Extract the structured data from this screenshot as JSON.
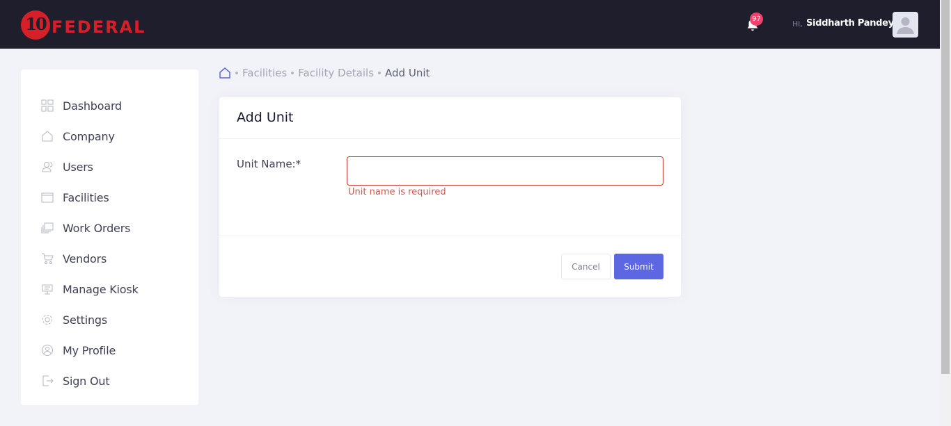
{
  "header": {
    "brand_number": "10",
    "brand_name": "FEDERAL",
    "notification_count": "97",
    "greeting": "Hi,",
    "user_name": "Siddharth Pandey"
  },
  "sidebar": {
    "items": [
      {
        "label": "Dashboard",
        "icon": "dashboard-icon"
      },
      {
        "label": "Company",
        "icon": "home-icon"
      },
      {
        "label": "Users",
        "icon": "users-icon"
      },
      {
        "label": "Facilities",
        "icon": "facilities-icon"
      },
      {
        "label": "Work Orders",
        "icon": "work-orders-icon"
      },
      {
        "label": "Vendors",
        "icon": "cart-icon"
      },
      {
        "label": "Manage Kiosk",
        "icon": "kiosk-icon"
      },
      {
        "label": "Settings",
        "icon": "gear-icon"
      },
      {
        "label": "My Profile",
        "icon": "profile-icon"
      },
      {
        "label": "Sign Out",
        "icon": "sign-out-icon"
      }
    ]
  },
  "breadcrumb": {
    "items": [
      "Facilities",
      "Facility Details"
    ],
    "current": "Add Unit"
  },
  "form": {
    "title": "Add Unit",
    "unit_name_label": "Unit Name:*",
    "unit_name_value": "",
    "unit_name_error": "Unit name is required",
    "cancel_label": "Cancel",
    "submit_label": "Submit"
  },
  "colors": {
    "header_bg": "#1e1e2d",
    "brand_red": "#d5202a",
    "primary": "#5c67e1",
    "error": "#d9534f",
    "badge": "#f1416c"
  }
}
